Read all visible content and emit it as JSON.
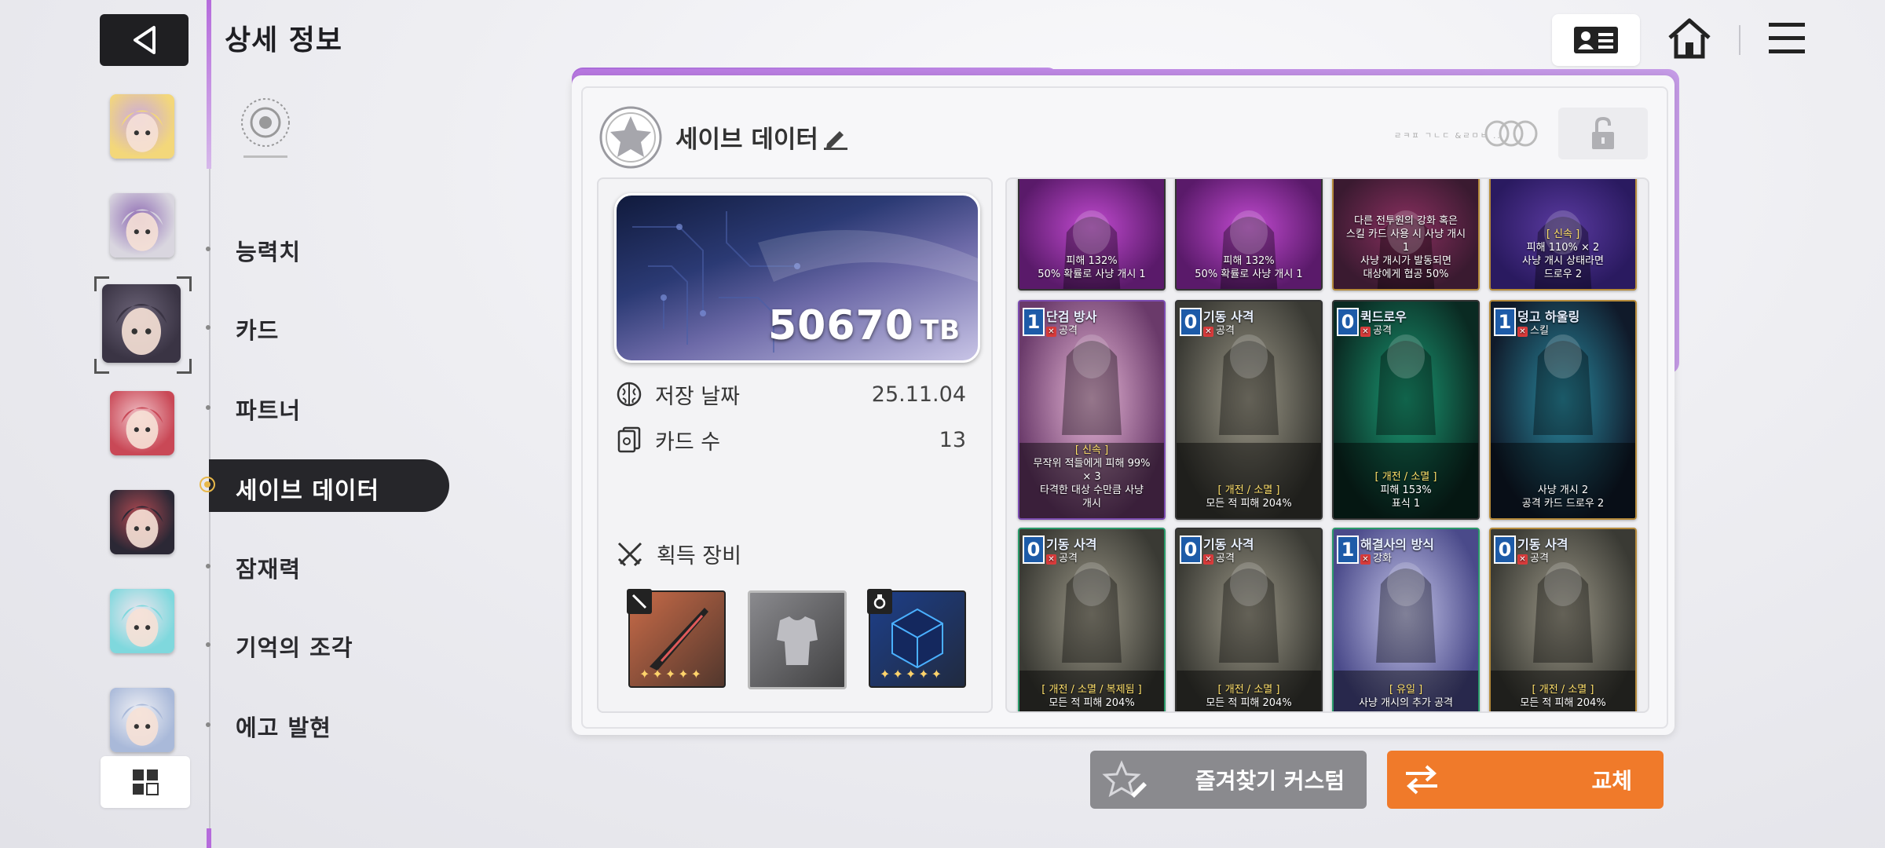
{
  "header": {
    "title": "상세 정보",
    "back_icon": "back-arrow-icon",
    "profile_icon": "profile-card-icon",
    "home_icon": "home-icon",
    "menu_icon": "hamburger-menu-icon"
  },
  "sidebar": {
    "portraits": [
      {
        "name": "portrait-1",
        "colors": [
          "#f3d77a",
          "#caa9e0"
        ]
      },
      {
        "name": "portrait-2",
        "colors": [
          "#d9d6df",
          "#8e6bb3"
        ]
      },
      {
        "name": "portrait-3",
        "colors": [
          "#3a3444",
          "#6c6478"
        ],
        "selected": true
      },
      {
        "name": "portrait-4",
        "colors": [
          "#c94856",
          "#f1c2c8"
        ]
      },
      {
        "name": "portrait-5",
        "colors": [
          "#2b2835",
          "#b24a52"
        ]
      },
      {
        "name": "portrait-6",
        "colors": [
          "#7fd8dd",
          "#f3e6ef"
        ]
      },
      {
        "name": "portrait-7",
        "colors": [
          "#a9b9d9",
          "#f2f2f6"
        ]
      }
    ],
    "grid_icon": "grid-view-icon"
  },
  "menu": {
    "items": [
      {
        "label": "능력치"
      },
      {
        "label": "카드"
      },
      {
        "label": "파트너"
      },
      {
        "label": "세이브 데이터",
        "active": true
      },
      {
        "label": "잠재력"
      },
      {
        "label": "기억의 조각"
      },
      {
        "label": "에고 발현"
      }
    ]
  },
  "save": {
    "name": "세이브 데이터",
    "tiny_text": "ㄹㅋㅍ ㄱㄴㄷ &ㄹㅁㅂ ..",
    "tb_value": "50670",
    "tb_unit": "TB",
    "date_label": "저장 날짜",
    "date_value": "25.11.04",
    "cards_label": "카드 수",
    "cards_value": "13",
    "gear_label": "획득 장비"
  },
  "equipment": [
    {
      "name": "weapon",
      "color": "#c96b48",
      "stars": "✦✦✦✦✦"
    },
    {
      "name": "armor",
      "color": "#8a8a8e",
      "stars": ""
    },
    {
      "name": "accessory",
      "color": "#1d3f8a",
      "stars": "✦✦✦✦✦"
    }
  ],
  "cards": [
    {
      "cost": "",
      "name": "",
      "type": "",
      "tag": "",
      "desc": "피해 132%\n50% 확률로 사냥 개시 1",
      "bg": [
        "#5a1a6a",
        "#c14ad0"
      ],
      "frame": "#333"
    },
    {
      "cost": "",
      "name": "",
      "type": "",
      "tag": "",
      "desc": "피해 132%\n50% 확률로 사냥 개시 1",
      "bg": [
        "#5a1a6a",
        "#c14ad0"
      ],
      "frame": "#333"
    },
    {
      "cost": "",
      "name": "",
      "type": "",
      "tag": "",
      "desc": "다른 전투원의 강화 혹은\n스킬 카드 사용 시 사냥 개시\n1\n사냥 개시가 발동되면\n대상에게 협공 50%",
      "bg": [
        "#3a1a30",
        "#8a3060"
      ],
      "frame": "#b58a3a"
    },
    {
      "cost": "",
      "name": "",
      "type": "",
      "tag": "[ 신속 ]",
      "desc": "피해 110% × 2\n사냥 개시 상태라면\n드로우 2",
      "bg": [
        "#2a1a60",
        "#5a3aa0"
      ],
      "frame": "#b58a3a"
    },
    {
      "cost": "1",
      "name": "단검 방사",
      "type": "공격",
      "tag": "[ 신속 ]",
      "desc": "무작위 적들에게 피해 99%\n× 3\n타격한 대상 수만큼 사냥\n개시",
      "bg": [
        "#6a3a6a",
        "#e6b6d6"
      ],
      "frame": "#7b4bb0"
    },
    {
      "cost": "0",
      "name": "기동 사격",
      "type": "공격",
      "tag": "[ 개전 / 소멸 ]",
      "desc": "모든 적 피해 204%",
      "bg": [
        "#3a3a34",
        "#9a9686"
      ],
      "frame": "#333"
    },
    {
      "cost": "0",
      "name": "퀵드로우",
      "type": "공격",
      "tag": "[ 개전 / 소멸 ]",
      "desc": "피해 153%\n표식 1",
      "bg": [
        "#0a2a22",
        "#1b9a74"
      ],
      "frame": "#333"
    },
    {
      "cost": "1",
      "name": "덩고 하울링",
      "type": "스킬",
      "tag": "",
      "desc": "사냥 개시 2\n공격 카드 드로우 2",
      "bg": [
        "#101a2a",
        "#2a8aa0"
      ],
      "frame": "#b58a3a"
    },
    {
      "cost": "0",
      "name": "기동 사격",
      "type": "공격",
      "tag": "[ 개전 / 소멸 / 복제됨 ]",
      "desc": "모든 적 피해 204%",
      "bg": [
        "#3a3a34",
        "#9a9686"
      ],
      "frame": "#2a9a6a"
    },
    {
      "cost": "0",
      "name": "기동 사격",
      "type": "공격",
      "tag": "[ 개전 / 소멸 ]",
      "desc": "모든 적 피해 204%",
      "bg": [
        "#3a3a34",
        "#9a9686"
      ],
      "frame": "#333"
    },
    {
      "cost": "1",
      "name": "해결사의 방식",
      "type": "강화",
      "tag": "[ 유일 ]",
      "desc": "사냥 개시의 추가 공격",
      "bg": [
        "#4a4a8a",
        "#c6c6ea"
      ],
      "frame": "#2a9a6a"
    },
    {
      "cost": "0",
      "name": "기동 사격",
      "type": "공격",
      "tag": "[ 개전 / 소멸 ]",
      "desc": "모든 적 피해 204%",
      "bg": [
        "#3a3a34",
        "#9a9686"
      ],
      "frame": "#b58a3a"
    }
  ],
  "buttons": {
    "favorite_label": "즐겨찾기 커스텀",
    "swap_label": "교체",
    "favorite_icon": "star-edit-icon",
    "swap_icon": "swap-arrows-icon"
  },
  "colors": {
    "accent_purple": "#b56bdc",
    "swap_orange": "#f07a2a",
    "dark": "#26262a"
  }
}
